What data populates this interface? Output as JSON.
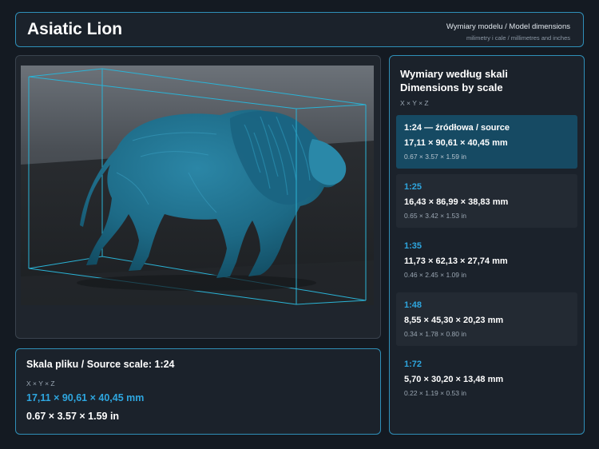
{
  "header": {
    "title": "Asiatic Lion",
    "subtitle": "Wymiary modelu / Model dimensions",
    "subtitle_small": "milimetry i cale / millimetres and inches"
  },
  "source": {
    "title": "Skala pliku / Source scale: 1:24",
    "axes": "X × Y × Z",
    "mm": "17,11 × 90,61 × 40,45 mm",
    "inches": "0.67 × 3.57 × 1.59 in"
  },
  "scales": {
    "title_line1": "Wymiary według skali",
    "title_line2": "Dimensions by scale",
    "axes": "X × Y × Z",
    "items": [
      {
        "label": "1:24  —  źródłowa / source",
        "mm": "17,11 × 90,61 × 40,45 mm",
        "inches": "0.67 × 3.57 × 1.59 in",
        "state": "active"
      },
      {
        "label": "1:25",
        "mm": "16,43 × 86,99 × 38,83 mm",
        "inches": "0.65 × 3.42 × 1.53 in",
        "state": "shaded"
      },
      {
        "label": "1:35",
        "mm": "11,73 × 62,13 × 27,74 mm",
        "inches": "0.46 × 2.45 × 1.09 in",
        "state": "plain"
      },
      {
        "label": "1:48",
        "mm": "8,55 × 45,30 × 20,23 mm",
        "inches": "0.34 × 1.78 × 0.80 in",
        "state": "shaded"
      },
      {
        "label": "1:72",
        "mm": "5,70 × 30,20 × 13,48 mm",
        "inches": "0.22 × 1.19 × 0.53 in",
        "state": "plain"
      }
    ]
  },
  "colors": {
    "accent": "#2ea6df",
    "border": "#2f8fb8",
    "active_card": "#164a63",
    "model": "#1f6f8c"
  },
  "image": {
    "subject": "lion-3d-model-render"
  }
}
